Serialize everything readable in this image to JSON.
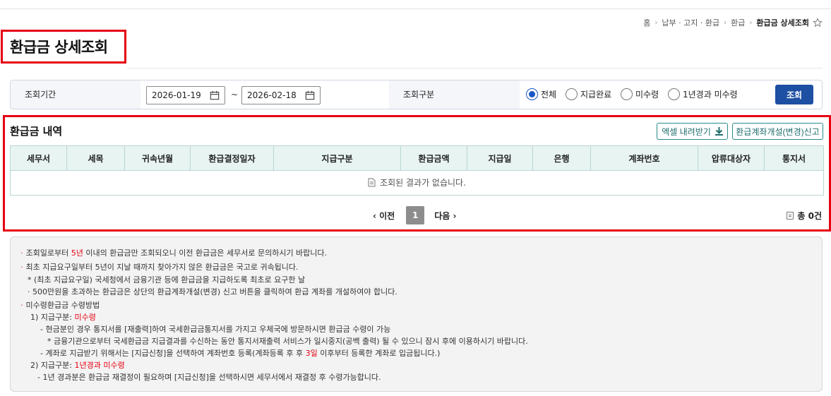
{
  "breadcrumb": {
    "home": "홈",
    "item1": "납부 · 고지 · 환급",
    "item2": "환급",
    "current": "환급금 상세조회"
  },
  "page": {
    "title": "환급금 상세조회"
  },
  "search": {
    "period_label": "조회기간",
    "date_from": "2026-01-19",
    "date_to": "2026-02-18",
    "tilde": "~",
    "type_label": "조회구분",
    "options": [
      "전체",
      "지급완료",
      "미수령",
      "1년경과 미수령"
    ],
    "selected": "전체",
    "button": "조회"
  },
  "result": {
    "title": "환급금 내역",
    "excel_button": "엑셀 내려받기",
    "account_button": "환급계좌개설(변경)신고",
    "columns": [
      "세무서",
      "세목",
      "귀속년월",
      "환급결정일자",
      "지급구분",
      "환급금액",
      "지급일",
      "은행",
      "계좌번호",
      "압류대상자",
      "통지서"
    ],
    "empty_message": "조회된 결과가 없습니다.",
    "pager": {
      "prev": "이전",
      "current_page": "1",
      "next": "다음"
    },
    "total": "총 0건"
  },
  "notice": {
    "l1_a": "조회일로부터 ",
    "l1_b": "5년",
    "l1_c": " 이내의 환급금만 조회되오니 이전 환급금은 세무서로 문의하시기 바랍니다.",
    "l2": "최초 지급요구일부터 5년이 지날 때까지 찾아가지 않은 환급금은 국고로 귀속됩니다.",
    "l3": "* (최초 지급요구일) 국세청에서 금융기관 등에 환급금을 지급하도록 최초로 요구한 날",
    "l4": "· 500만원을 초과하는 환급금은 상단의 환급계좌개설(변경) 신고 버튼을 클릭하여 환급 계좌를 개설하여야 합니다.",
    "l5": "미수령환급금 수령방법",
    "l6_a": "1) 지급구분: ",
    "l6_b": "미수령",
    "l7": "- 현금분인 경우 통지서를 [재출력]하여 국세환급금통지서를 가지고 우체국에 방문하시면 환급금 수령이 가능",
    "l8": "* 금융기관으로부터 국세환급금 지급결과를 수신하는 동안 통지서재출력 서비스가 일시중지(공백 출력) 될 수 있으니 잠시 후에 이용하시기 바랍니다.",
    "l9_a": "- 계좌로 지급받기 위해서는 [지급신청]을 선택하여 계좌번호 등록(계좌등록 후 후 ",
    "l9_b": "3일",
    "l9_c": " 이후부터 등록한 계좌로 입금됩니다.)",
    "l10_a": "2) 지급구분: ",
    "l10_b": "1년경과 미수령",
    "l11": "- 1년 경과분은 환급금 재결정이 필요하며 [지급신청]을 선택하시면 세무서에서 재결정 후 수령가능합니다."
  },
  "colors": {
    "red_highlight": "#e60012",
    "primary": "#1d4fa3",
    "teal": "#2a8a8a",
    "header_bg": "#e8f4f2"
  }
}
